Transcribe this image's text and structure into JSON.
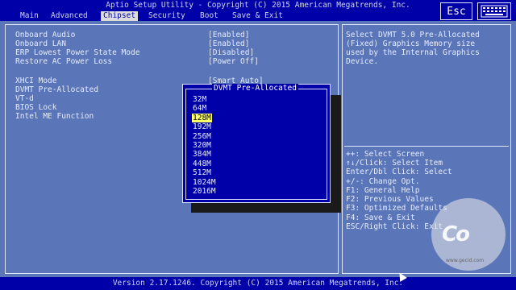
{
  "header": {
    "title": "Aptio Setup Utility - Copyright (C) 2015 American Megatrends, Inc.",
    "tabs": [
      "Main",
      "Advanced",
      "Chipset",
      "Security",
      "Boot",
      "Save & Exit"
    ],
    "active_tab": "Chipset",
    "esc_label": "Esc",
    "keyboard_icon": "keyboard-icon"
  },
  "settings": [
    {
      "label": "Onboard Audio",
      "value": "[Enabled]"
    },
    {
      "label": "Onboard LAN",
      "value": "[Enabled]"
    },
    {
      "label": "ERP Lowest Power State Mode",
      "value": "[Disabled]"
    },
    {
      "label": "Restore AC Power Loss",
      "value": "[Power Off]"
    },
    {
      "label": "XHCI Mode",
      "value": "[Smart Auto]"
    },
    {
      "label": "DVMT Pre-Allocated",
      "value": ""
    },
    {
      "label": "VT-d",
      "value": ""
    },
    {
      "label": "BIOS Lock",
      "value": ""
    },
    {
      "label": "Intel ME Function",
      "value": ""
    }
  ],
  "popup": {
    "title": "DVMT Pre-Allocated",
    "options": [
      "32M",
      "64M",
      "128M",
      "192M",
      "256M",
      "320M",
      "384M",
      "448M",
      "512M",
      "1024M",
      "2016M"
    ],
    "selected": "128M"
  },
  "help": {
    "description": [
      "Select DVMT 5.0 Pre-Allocated",
      "(Fixed) Graphics Memory size",
      "used by the Internal Graphics",
      "Device."
    ],
    "keys": [
      "++: Select Screen",
      "↑↓/Click: Select Item",
      "Enter/Dbl Click: Select",
      "+/-: Change Opt.",
      "F1: General Help",
      "F2: Previous Values",
      "F3: Optimized Defaults",
      "F4: Save & Exit",
      "ESC/Right Click: Exit"
    ]
  },
  "footer": {
    "version": "Version 2.17.1246. Copyright (C) 2015 American Megatrends, Inc."
  },
  "watermark": {
    "text": "Co",
    "url": "www.gecid.com"
  },
  "colors": {
    "bg": "#5b76b8",
    "bar": "#0000a8",
    "highlight": "#ffff66"
  }
}
